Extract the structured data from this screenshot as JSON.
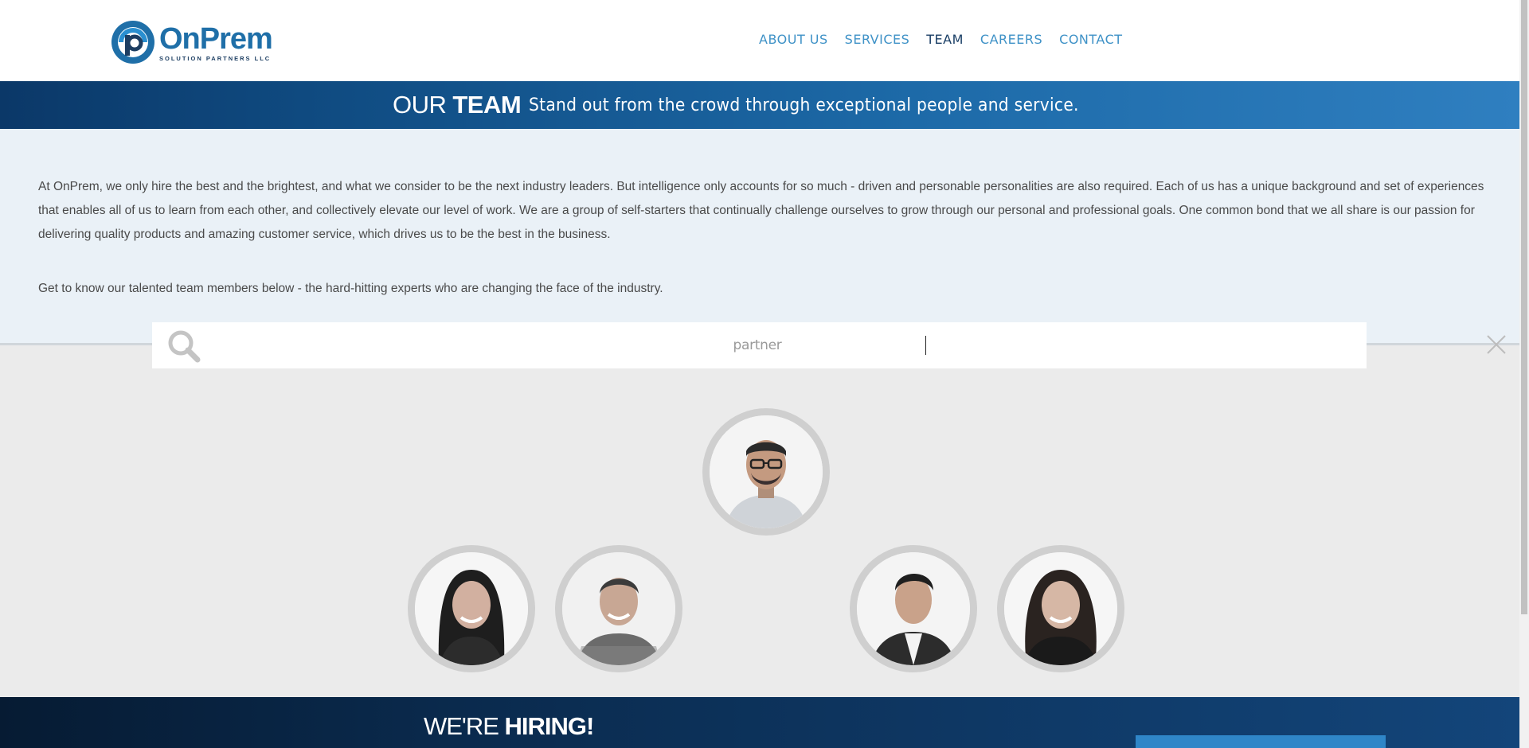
{
  "brand": {
    "name": "OnPrem",
    "subtitle": "SOLUTION PARTNERS LLC",
    "primary_color": "#1f6fa8",
    "dark_color": "#1b3f66"
  },
  "nav": {
    "items": [
      {
        "label": "ABOUT US",
        "active": false
      },
      {
        "label": "SERVICES",
        "active": false
      },
      {
        "label": "TEAM",
        "active": true
      },
      {
        "label": "CAREERS",
        "active": false
      },
      {
        "label": "CONTACT",
        "active": false
      }
    ]
  },
  "title_band": {
    "our": "OUR",
    "team": "TEAM",
    "tagline": "Stand out from the crowd through exceptional people and service."
  },
  "intro": {
    "paragraph1": "At OnPrem, we only hire the best and the brightest, and what we consider to be the next industry leaders. But intelligence only accounts for so much - driven and personable personalities are also required. Each of us has a unique background and set of experiences that enables all of us to learn from each other, and collectively elevate our level of work. We are a group of self-starters that continually challenge ourselves to grow through our personal and professional goals. One common bond that we all share is our passion for delivering quality products and amazing customer service, which drives us to be the best in the business.",
    "paragraph2": "Get to know our talented team members below - the hard-hitting experts who are changing the face of the industry."
  },
  "search": {
    "value": "partner",
    "icon": "search-icon",
    "clear_icon": "close-icon"
  },
  "hiring": {
    "prefix": "WE'RE",
    "bold": "HIRING!"
  }
}
